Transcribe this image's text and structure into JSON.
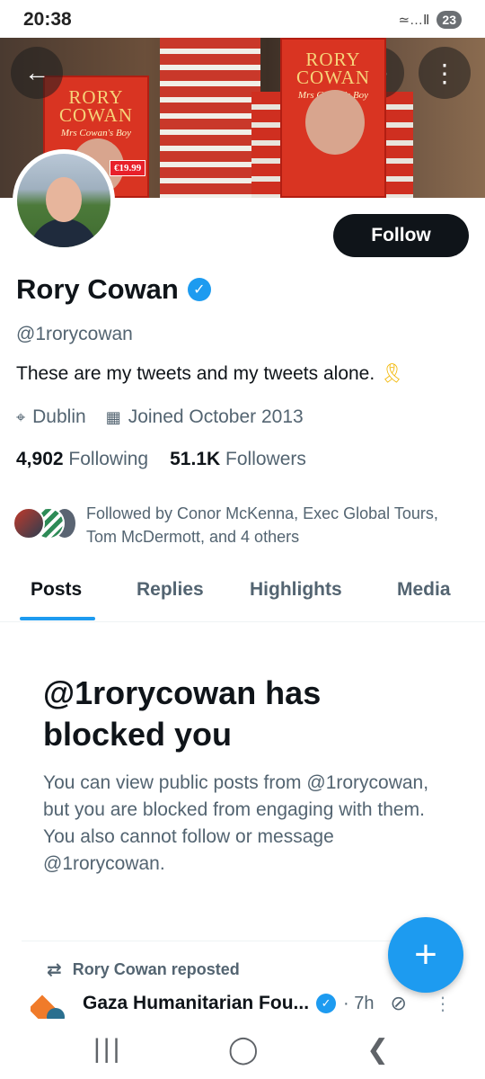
{
  "status_bar": {
    "time": "20:38",
    "signal_text": "≃…Ⅱ",
    "battery": "23"
  },
  "banner": {
    "book_title": "RORY COWAN",
    "book_subtitle": "Mrs Cowan's Boy",
    "price_tag": "€19.99"
  },
  "header_icons": {
    "back": "←",
    "grok": "⊘",
    "more": "⋮"
  },
  "profile": {
    "display_name": "Rory Cowan",
    "verified_mark": "✓",
    "handle": "@1rorycowan",
    "bio": "These are my tweets and my tweets alone.",
    "bio_emoji": "🎗",
    "location_icon": "⌖",
    "location": "Dublin",
    "calendar_icon": "▦",
    "joined": "Joined October 2013",
    "following_count": "4,902",
    "following_label": "Following",
    "followers_count": "51.1K",
    "followers_label": "Followers",
    "followed_by": "Followed by Conor McKenna, Exec Global Tours, Tom McDermott, and 4 others"
  },
  "follow_button": {
    "label": "Follow"
  },
  "tabs": [
    {
      "label": "Posts",
      "active": true
    },
    {
      "label": "Replies",
      "active": false
    },
    {
      "label": "Highlights",
      "active": false
    },
    {
      "label": "Media",
      "active": false
    }
  ],
  "blocked": {
    "title": "@1rorycowan has blocked you",
    "body": "You can view public posts from @1rorycowan, but you are blocked from engaging with them. You also cannot follow or message @1rorycowan."
  },
  "repost": {
    "icon": "⇄",
    "label": "Rory Cowan reposted",
    "author": "Gaza Humanitarian Fou...",
    "verified_mark": "✓",
    "time": "· 7h",
    "grok_icon": "⊘",
    "more_icon": "⋮"
  },
  "fab": {
    "icon": "+"
  },
  "nav": {
    "recents": "|||",
    "home": "◯",
    "back": "❮"
  },
  "colors": {
    "accent": "#1d9bf0",
    "text": "#0f1419",
    "secondary": "#536471"
  }
}
